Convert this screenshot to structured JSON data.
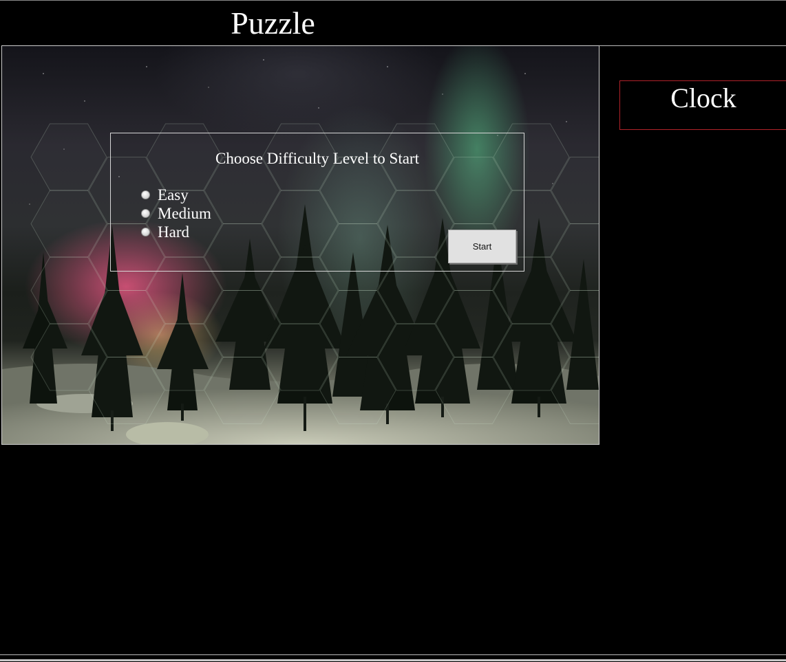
{
  "page": {
    "title": "Puzzle"
  },
  "clock": {
    "label": "Clock"
  },
  "start_dialog": {
    "heading": "Choose Difficulty Level to Start",
    "difficulty_options": [
      {
        "label": "Easy"
      },
      {
        "label": "Medium"
      },
      {
        "label": "Hard"
      }
    ],
    "start_label": "Start"
  },
  "board": {
    "image": "aurora-forest-snow-background",
    "overlay": "hexagon-grid"
  },
  "colors": {
    "background": "#000000",
    "clock_border": "#b3232a",
    "text": "#ffffff"
  }
}
